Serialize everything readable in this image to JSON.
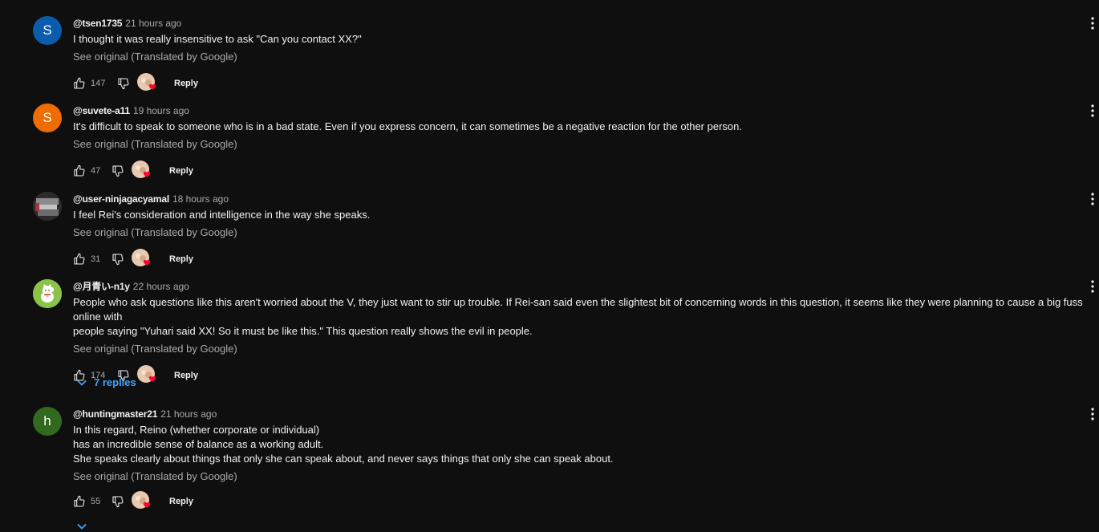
{
  "comments": [
    {
      "author": "@tsen1735",
      "time": "21 hours ago",
      "text": "I thought it was really insensitive to ask \"Can you contact XX?\"",
      "see_original": "See original (Translated by Google)",
      "likes": "147",
      "reply_label": "Reply",
      "avatar_letter": "S",
      "avatar_color": "#0b5cad"
    },
    {
      "author": "@suvete-a11",
      "time": "19 hours ago",
      "text": "It's difficult to speak to someone who is in a bad state. Even if you express concern, it can sometimes be a negative reaction for the other person.",
      "see_original": "See original (Translated by Google)",
      "likes": "47",
      "reply_label": "Reply",
      "avatar_letter": "S",
      "avatar_color": "#ef6c00"
    },
    {
      "author": "@user-ninjagacyamal",
      "time": "18 hours ago",
      "text": "I feel Rei's consideration and intelligence in the way she speaks.",
      "see_original": "See original (Translated by Google)",
      "likes": "31",
      "reply_label": "Reply",
      "avatar_letter": "",
      "avatar_color": "#3a3a3a"
    },
    {
      "author": "@月青い-n1y",
      "time": "22 hours ago",
      "text": "People who ask questions like this aren't worried about the V, they just want to stir up trouble. If Rei-san said even the slightest bit of concerning words in this question, it seems like they were planning to cause a big fuss online with\npeople saying \"Yuhari said XX! So it must be like this.\" This question really shows the evil in people.",
      "see_original": "See original (Translated by Google)",
      "likes": "174",
      "reply_label": "Reply",
      "avatar_letter": "",
      "avatar_color": "#8bc34a",
      "replies_label": "7 replies"
    },
    {
      "author": "@huntingmaster21",
      "time": "21 hours ago",
      "text": "In this regard, Reino (whether corporate or individual)\nhas an incredible sense of balance as a working adult.\nShe speaks clearly about things that only she can speak about, and never says things that only she can speak about.",
      "see_original": "See original (Translated by Google)",
      "likes": "55",
      "reply_label": "Reply",
      "avatar_letter": "h",
      "avatar_color": "#33691e"
    }
  ],
  "colors": {
    "link": "#3ea6ff",
    "heart": "#ff0033",
    "muted": "#aaaaaa"
  }
}
